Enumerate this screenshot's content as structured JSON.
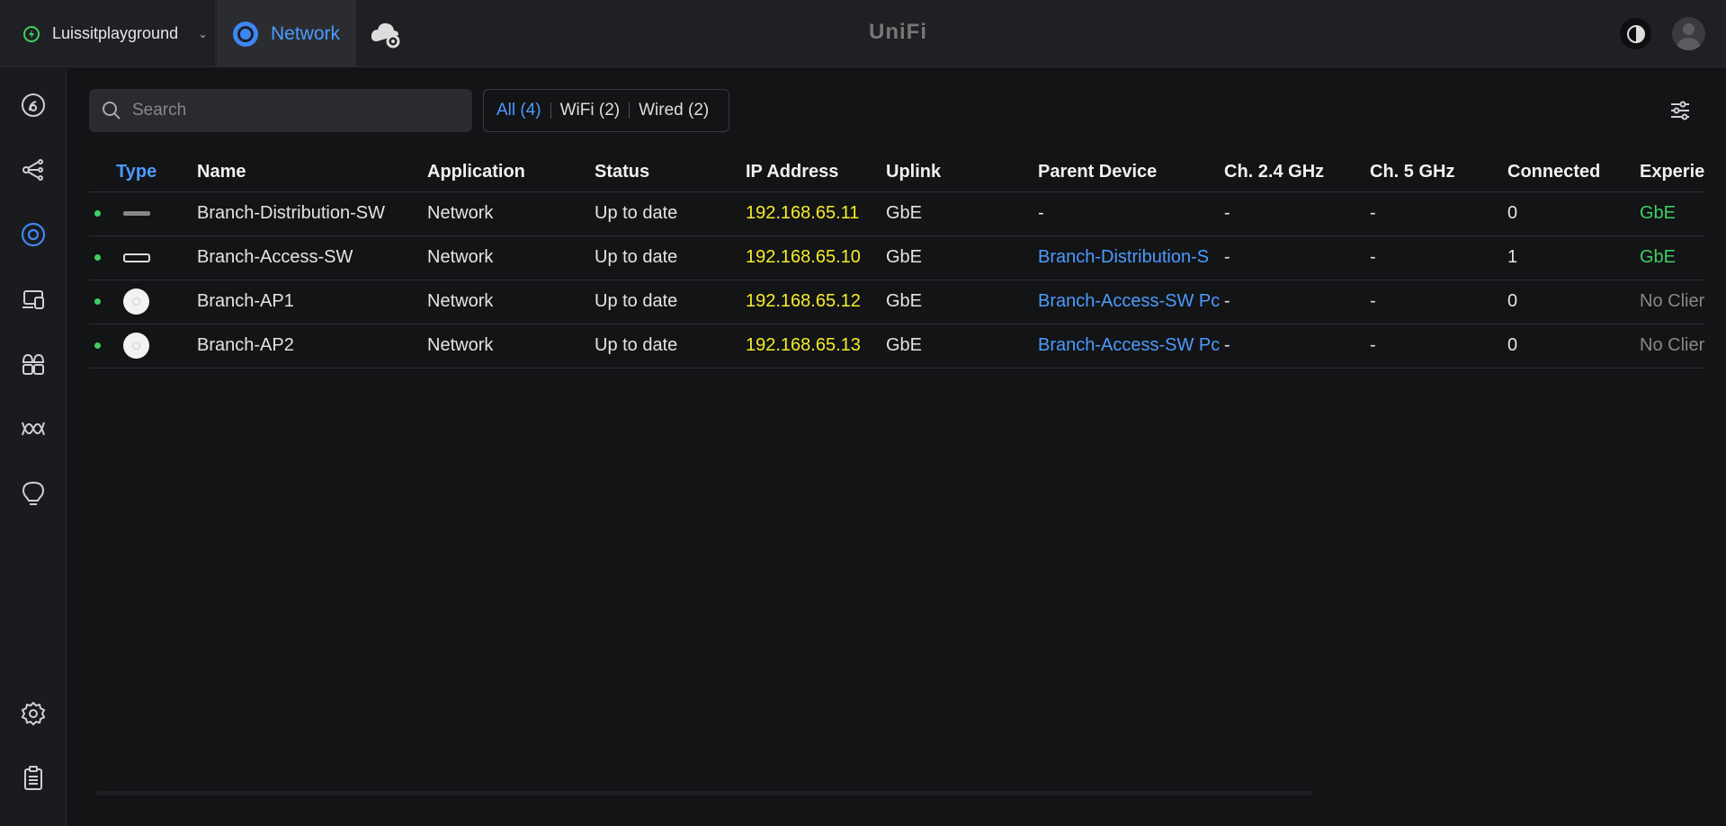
{
  "header": {
    "site_name": "Luissitplayground",
    "app_tab": "Network",
    "logo": "UniFi",
    "icons": {
      "site": "power-icon",
      "app": "network-ring-icon",
      "cloud": "cloud-gear-icon",
      "theme": "contrast-icon",
      "avatar": "user-avatar"
    }
  },
  "sidebar": {
    "items": [
      {
        "name": "dashboard-icon"
      },
      {
        "name": "topology-icon"
      },
      {
        "name": "devices-icon",
        "active": true
      },
      {
        "name": "client-devices-icon"
      },
      {
        "name": "applications-icon"
      },
      {
        "name": "insights-icon"
      },
      {
        "name": "alerts-icon"
      },
      {
        "name": "settings-icon"
      },
      {
        "name": "logs-icon"
      }
    ]
  },
  "toolbar": {
    "search_placeholder": "Search",
    "filters": [
      {
        "label": "All (4)",
        "active": true
      },
      {
        "label": "WiFi (2)",
        "active": false
      },
      {
        "label": "Wired (2)",
        "active": false
      }
    ]
  },
  "table": {
    "columns": [
      "Type",
      "Name",
      "Application",
      "Status",
      "IP Address",
      "Uplink",
      "Parent Device",
      "Ch. 2.4 GHz",
      "Ch. 5 GHz",
      "Connected",
      "Experien"
    ],
    "rows": [
      {
        "type": "switch-flat",
        "name": "Branch-Distribution-SW",
        "application": "Network",
        "status": "Up to date",
        "ip": "192.168.65.11",
        "uplink": "GbE",
        "parent": "-",
        "ch24": "-",
        "ch5": "-",
        "connected": "0",
        "experience": "GbE"
      },
      {
        "type": "switch",
        "name": "Branch-Access-SW",
        "application": "Network",
        "status": "Up to date",
        "ip": "192.168.65.10",
        "uplink": "GbE",
        "parent": "Branch-Distribution-S",
        "ch24": "-",
        "ch5": "-",
        "connected": "1",
        "experience": "GbE"
      },
      {
        "type": "ap",
        "name": "Branch-AP1",
        "application": "Network",
        "status": "Up to date",
        "ip": "192.168.65.12",
        "uplink": "GbE",
        "parent": "Branch-Access-SW Pc",
        "ch24": "-",
        "ch5": "-",
        "connected": "0",
        "experience": "No Clier"
      },
      {
        "type": "ap",
        "name": "Branch-AP2",
        "application": "Network",
        "status": "Up to date",
        "ip": "192.168.65.13",
        "uplink": "GbE",
        "parent": "Branch-Access-SW Pc",
        "ch24": "-",
        "ch5": "-",
        "connected": "0",
        "experience": "No Clier"
      }
    ]
  },
  "colors": {
    "accent": "#4d9bff",
    "online": "#3ecf62",
    "ip": "#f5ec2a",
    "background": "#131416"
  }
}
